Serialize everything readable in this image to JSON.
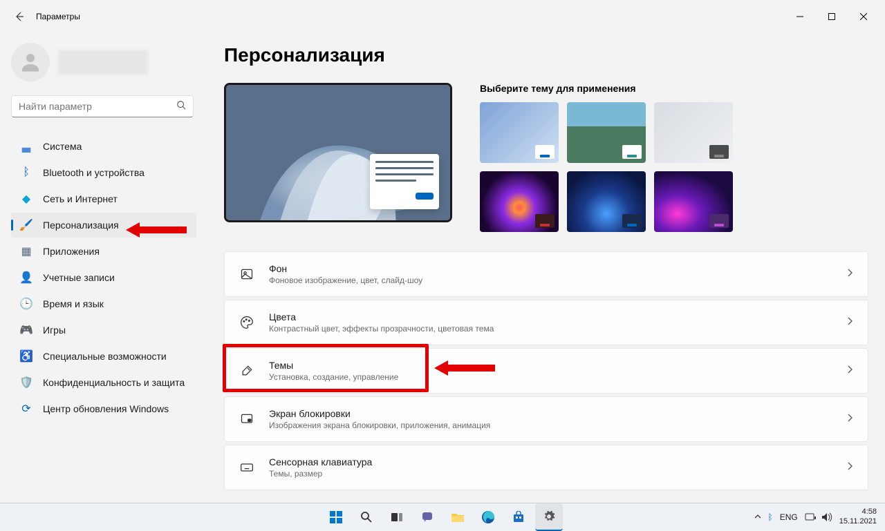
{
  "window": {
    "title": "Параметры"
  },
  "search": {
    "placeholder": "Найти параметр"
  },
  "nav": [
    {
      "label": "Система",
      "icon": "🖥️",
      "color": "#0067c0"
    },
    {
      "label": "Bluetooth и устройства",
      "icon": "ᛒ",
      "color": "#0067c0"
    },
    {
      "label": "Сеть и Интернет",
      "icon": "◆",
      "color": "#0aa5d8"
    },
    {
      "label": "Персонализация",
      "icon": "🖌️",
      "color": "#d88a3a",
      "active": true
    },
    {
      "label": "Приложения",
      "icon": "▦",
      "color": "#5a6b7f"
    },
    {
      "label": "Учетные записи",
      "icon": "👤",
      "color": "#2aa86a"
    },
    {
      "label": "Время и язык",
      "icon": "🌐",
      "color": "#5a8ad8"
    },
    {
      "label": "Игры",
      "icon": "🎮",
      "color": "#888"
    },
    {
      "label": "Специальные возможности",
      "icon": "♿",
      "color": "#4a7ad8"
    },
    {
      "label": "Конфиденциальность и защита",
      "icon": "🛡️",
      "color": "#888"
    },
    {
      "label": "Центр обновления Windows",
      "icon": "🔄",
      "color": "#0067c0"
    }
  ],
  "page": {
    "title": "Персонализация"
  },
  "themes": {
    "heading": "Выберите тему для применения"
  },
  "cards": [
    {
      "title": "Фон",
      "sub": "Фоновое изображение, цвет, слайд-шоу"
    },
    {
      "title": "Цвета",
      "sub": "Контрастный цвет, эффекты прозрачности, цветовая тема"
    },
    {
      "title": "Темы",
      "sub": "Установка, создание, управление"
    },
    {
      "title": "Экран блокировки",
      "sub": "Изображения экрана блокировки, приложения, анимация"
    },
    {
      "title": "Сенсорная клавиатура",
      "sub": "Темы, размер"
    }
  ],
  "tray": {
    "lang": "ENG",
    "time": "4:58",
    "date": "15.11.2021"
  }
}
